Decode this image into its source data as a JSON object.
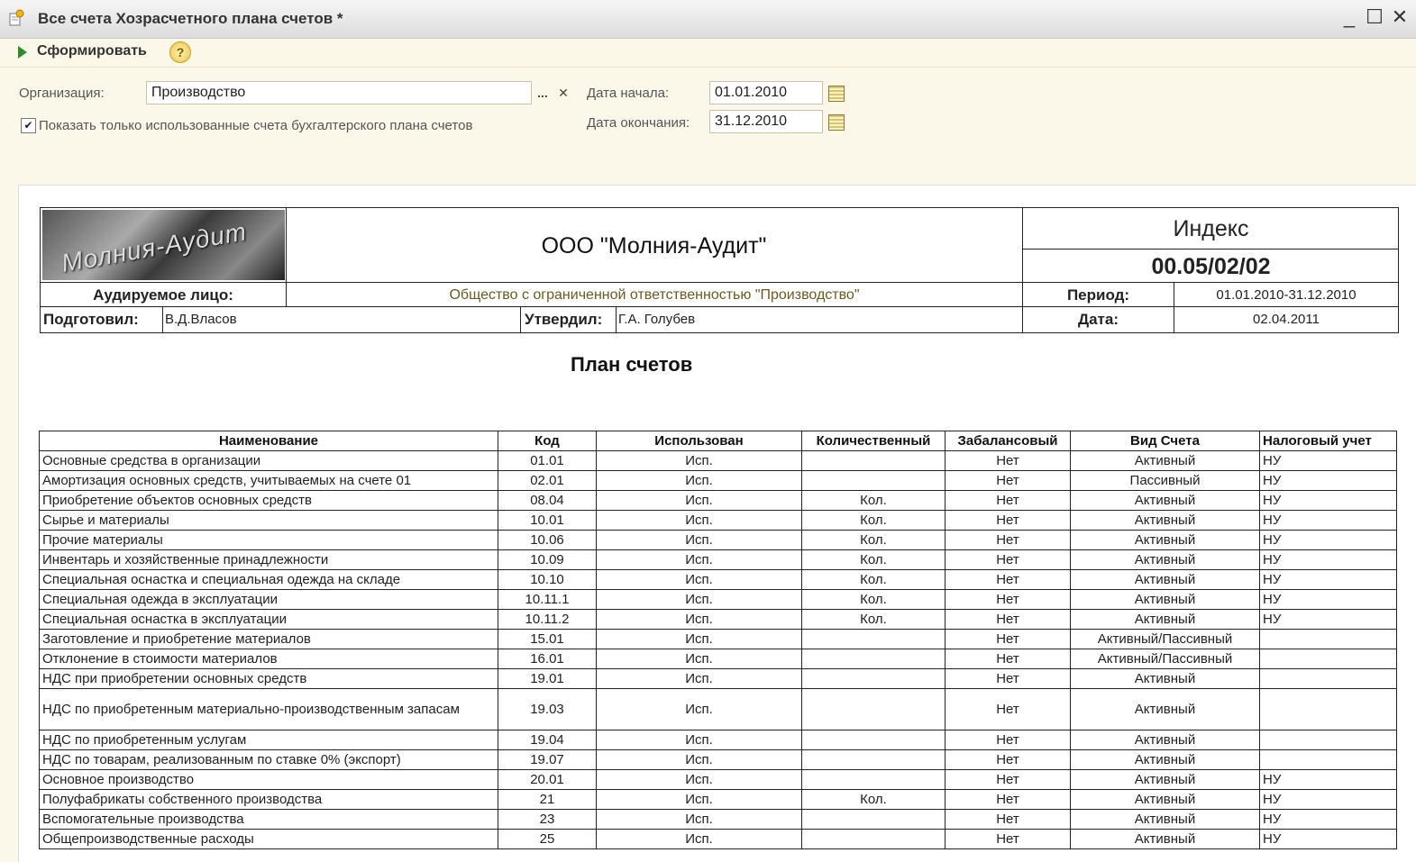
{
  "window": {
    "title": "Все счета Хозрасчетного плана счетов *",
    "minimize": "_",
    "maximize": "☐",
    "close": "✕"
  },
  "toolbar": {
    "generate_label": "Сформировать",
    "help": "?"
  },
  "form": {
    "org_label": "Организация:",
    "org_value": "Производство",
    "org_select": "...",
    "org_clear": "✕",
    "date_start_label": "Дата начала:",
    "date_start_value": "01.01.2010",
    "date_end_label": "Дата окончания:",
    "date_end_value": "31.12.2010",
    "only_used_label": "Показать только использованные счета бухгалтерского плана счетов",
    "only_used_checked": true
  },
  "report": {
    "logo_text": "Молния-Аудит",
    "company": "ООО \"Молния-Аудит\"",
    "index_label": "Индекс",
    "index_value": "00.05/02/02",
    "audited_label": "Аудируемое лицо:",
    "audited_value": "Общество с ограниченной ответственностью \"Производство\"",
    "period_label": "Период:",
    "period_value": "01.01.2010-31.12.2010",
    "prepared_label": "Подготовил:",
    "prepared_value": "В.Д.Власов",
    "approved_label": "Утвердил:",
    "approved_value": "Г.А. Голубев",
    "date_label": "Дата:",
    "date_value": "02.04.2011",
    "title": "План счетов"
  },
  "table": {
    "columns": [
      "Наименование",
      "Код",
      "Использован",
      "Количественный",
      "Забалансовый",
      "Вид Счета",
      "Налоговый учет"
    ],
    "rows": [
      [
        "Основные средства в организации",
        "01.01",
        "Исп.",
        "",
        "Нет",
        "Активный",
        "НУ"
      ],
      [
        "Амортизация основных средств, учитываемых на счете 01",
        "02.01",
        "Исп.",
        "",
        "Нет",
        "Пассивный",
        "НУ"
      ],
      [
        "Приобретение объектов основных средств",
        "08.04",
        "Исп.",
        "Кол.",
        "Нет",
        "Активный",
        "НУ"
      ],
      [
        "Сырье и материалы",
        "10.01",
        "Исп.",
        "Кол.",
        "Нет",
        "Активный",
        "НУ"
      ],
      [
        "Прочие материалы",
        "10.06",
        "Исп.",
        "Кол.",
        "Нет",
        "Активный",
        "НУ"
      ],
      [
        "Инвентарь и хозяйственные принадлежности",
        "10.09",
        "Исп.",
        "Кол.",
        "Нет",
        "Активный",
        "НУ"
      ],
      [
        "Специальная оснастка и специальная одежда на складе",
        "10.10",
        "Исп.",
        "Кол.",
        "Нет",
        "Активный",
        "НУ"
      ],
      [
        "Специальная одежда в эксплуатации",
        "10.11.1",
        "Исп.",
        "Кол.",
        "Нет",
        "Активный",
        "НУ"
      ],
      [
        "Специальная оснастка в эксплуатации",
        "10.11.2",
        "Исп.",
        "Кол.",
        "Нет",
        "Активный",
        "НУ"
      ],
      [
        "Заготовление и приобретение материалов",
        "15.01",
        "Исп.",
        "",
        "Нет",
        "Активный/Пассивный",
        ""
      ],
      [
        "Отклонение в стоимости материалов",
        "16.01",
        "Исп.",
        "",
        "Нет",
        "Активный/Пассивный",
        ""
      ],
      [
        "НДС при приобретении основных средств",
        "19.01",
        "Исп.",
        "",
        "Нет",
        "Активный",
        ""
      ],
      [
        "НДС по приобретенным материально-производственным запасам",
        "19.03",
        "Исп.",
        "",
        "Нет",
        "Активный",
        ""
      ],
      [
        "НДС по приобретенным услугам",
        "19.04",
        "Исп.",
        "",
        "Нет",
        "Активный",
        ""
      ],
      [
        "НДС по товарам, реализованным по ставке 0% (экспорт)",
        "19.07",
        "Исп.",
        "",
        "Нет",
        "Активный",
        ""
      ],
      [
        "Основное производство",
        "20.01",
        "Исп.",
        "",
        "Нет",
        "Активный",
        "НУ"
      ],
      [
        "Полуфабрикаты собственного производства",
        "21",
        "Исп.",
        "Кол.",
        "Нет",
        "Активный",
        "НУ"
      ],
      [
        "Вспомогательные производства",
        "23",
        "Исп.",
        "",
        "Нет",
        "Активный",
        "НУ"
      ],
      [
        "Общепроизводственные расходы",
        "25",
        "Исп.",
        "",
        "Нет",
        "Активный",
        "НУ"
      ]
    ]
  }
}
